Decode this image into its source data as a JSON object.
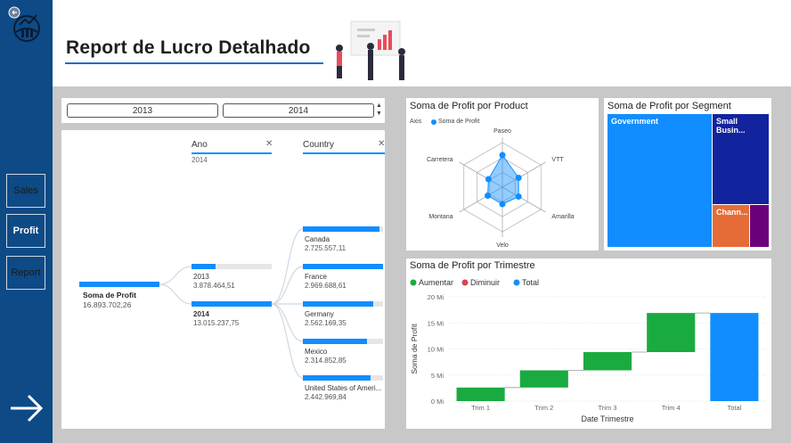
{
  "nav": {
    "sales_label": "Sales",
    "profit_label": "Profit",
    "report_label": "Report"
  },
  "header": {
    "title": "Report de Lucro Detalhado"
  },
  "slicer": {
    "options": [
      "2013",
      "2014"
    ]
  },
  "decomposition": {
    "levels": [
      {
        "label": "Ano",
        "selected": "2014"
      },
      {
        "label": "Country"
      }
    ],
    "root": {
      "label": "Soma de Profit",
      "value": "16.893.702,26"
    },
    "years": [
      {
        "label": "2013",
        "value": "3.878.464,51",
        "fraction": 0.3
      },
      {
        "label": "2014",
        "value": "13.015.237,75",
        "fraction": 1.0
      }
    ],
    "countries": [
      {
        "label": "Canada",
        "value": "2.725.557,11",
        "fraction": 0.95
      },
      {
        "label": "France",
        "value": "2.969.688,61",
        "fraction": 1.0
      },
      {
        "label": "Germany",
        "value": "2.562.169,35",
        "fraction": 0.88
      },
      {
        "label": "Mexico",
        "value": "2.314.852,85",
        "fraction": 0.8
      },
      {
        "label": "United States of Ameri...",
        "value": "2.442.969,84",
        "fraction": 0.84
      }
    ]
  },
  "radar": {
    "title": "Soma de Profit por Product",
    "legend_axis": "Axis",
    "legend_series": "Soma de Profit",
    "axes": [
      {
        "label": "Paseo",
        "value": 0.72
      },
      {
        "label": "VTT",
        "value": 0.42
      },
      {
        "label": "Amarilla",
        "value": 0.42
      },
      {
        "label": "Velo",
        "value": 0.38
      },
      {
        "label": "Montana",
        "value": 0.38
      },
      {
        "label": "Carretera",
        "value": 0.36
      }
    ]
  },
  "segment": {
    "title": "Soma de Profit por Segment",
    "items": [
      "Government",
      "Small Busin...",
      "Chann..."
    ],
    "colors": {
      "government": "#118dff",
      "small_business": "#12239e",
      "channel": "#e66c37",
      "other": "#6b007b"
    }
  },
  "chart_data": {
    "type": "waterfall",
    "title": "Soma de Profit por Trimestre",
    "xlabel": "Date Trimestre",
    "ylabel": "Soma de Profit",
    "legend": [
      "Aumentar",
      "Diminuir",
      "Total"
    ],
    "legend_colors": [
      "#1aab40",
      "#d64550",
      "#118dff"
    ],
    "categories": [
      "Trim 1",
      "Trim 2",
      "Trim 3",
      "Trim 4",
      "Total"
    ],
    "values": [
      2.6,
      3.3,
      3.5,
      7.5,
      16.9
    ],
    "yticks": [
      "0 Mi",
      "5 Mi",
      "10 Mi",
      "15 Mi",
      "20 Mi"
    ],
    "ylim": [
      0,
      20
    ],
    "unit": "Mi"
  }
}
